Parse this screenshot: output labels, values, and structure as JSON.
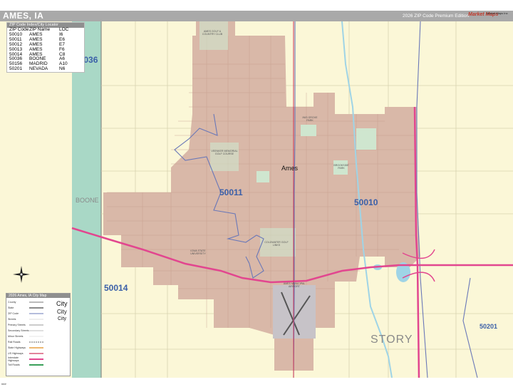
{
  "header": {
    "title": "AMES, IA",
    "edition": "2026 ZIP Code Premium Edition",
    "logo_mark": "Market Maps",
    "logo_sub": "Market Maps Inc"
  },
  "zip_index": {
    "title": "ZIP Code Index/City Locator",
    "columns": [
      "ZIP Code",
      "ZIP Name",
      "LOC"
    ],
    "rows": [
      [
        "50010",
        "AMES",
        "I6"
      ],
      [
        "50011",
        "AMES",
        "E6"
      ],
      [
        "50012",
        "AMES",
        "E7"
      ],
      [
        "50013",
        "AMES",
        "F6"
      ],
      [
        "50014",
        "AMES",
        "C8"
      ],
      [
        "50036",
        "BOONE",
        "A6"
      ],
      [
        "50156",
        "MADRID",
        "A10"
      ],
      [
        "50201",
        "NEVADA",
        "N6"
      ]
    ]
  },
  "map_labels": {
    "city": "Ames",
    "zips": {
      "z50036": "50036",
      "z50011": "50011",
      "z50010": "50010",
      "z50014": "50014",
      "z50201": "50201"
    },
    "counties": {
      "boone": "BOONE",
      "story": "STORY"
    },
    "features": {
      "golf_country_club": "AMES GOLF & COUNTRY CLUB",
      "veenker": "VEENKER MEMORIAL GOLF COURSE",
      "iowa_state": "IOWA STATE UNIVERSITY",
      "coldwater": "COLDWATER GOLF LINKS",
      "airport": "AMES MUNICIPAL AIRPORT",
      "inis_grove": "INIS GROVE PARK",
      "brookside": "BROOKSIDE PARK"
    }
  },
  "legend": {
    "title": "2026 Ames, IA City Map",
    "rows": [
      "County",
      "State",
      "ZIP Code",
      "Streets",
      "Primary Streets",
      "Secondary Streets",
      "Minor Streets",
      "Rail Roads",
      "State Highways",
      "US Highways",
      "Interstate Highways",
      "Toll Roads"
    ],
    "city_samples": [
      "City",
      "City",
      "City"
    ]
  },
  "footer": {
    "code": "###"
  },
  "colors": {
    "urban": "#d9b8a8",
    "rural": "#fbf7d7",
    "zip_boundary": "#6a78b8",
    "interstate": "#e2468f",
    "water": "#9fd4e6",
    "park": "#cfe6cf",
    "county_strip": "#a9d8c6"
  }
}
